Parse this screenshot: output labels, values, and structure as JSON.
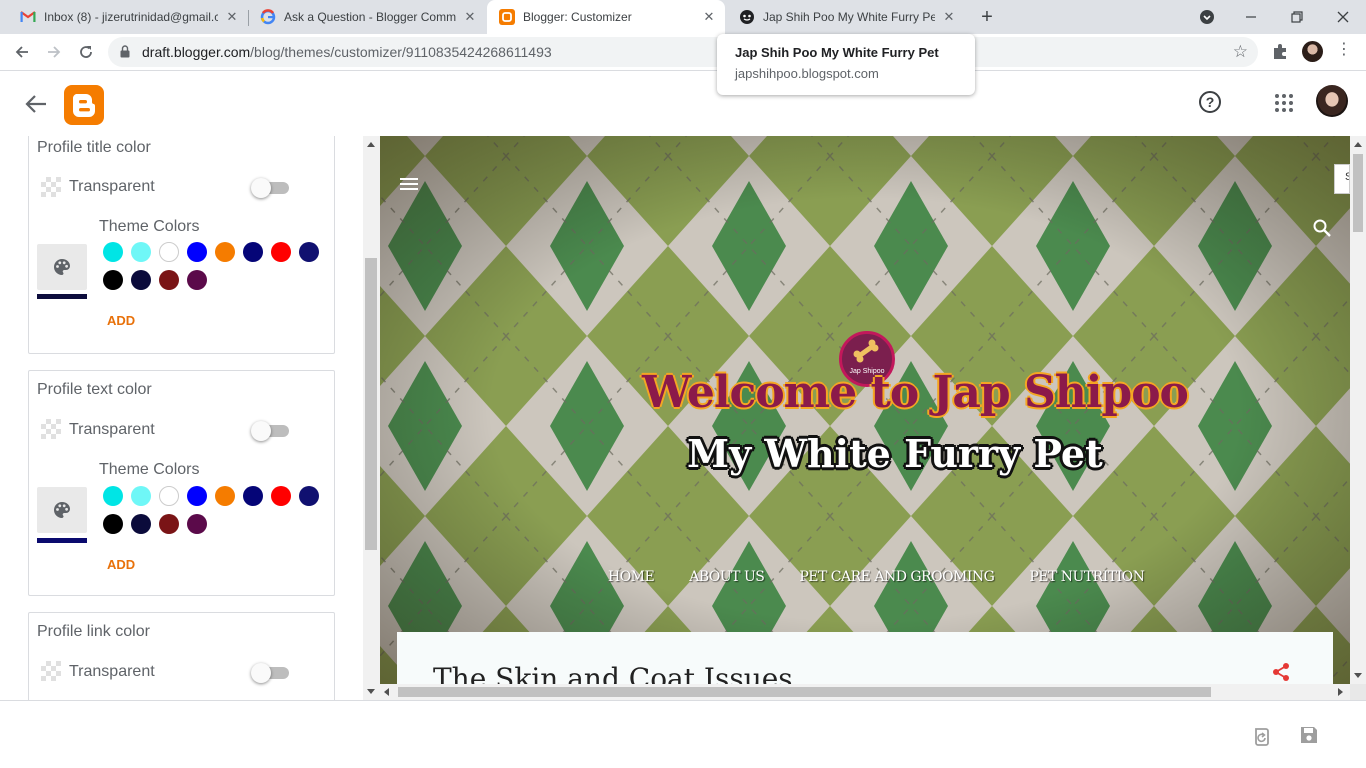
{
  "browser": {
    "tabs": [
      {
        "title": "Inbox (8) - jizerutrinidad@gmail.c",
        "favicon": "gmail-icon",
        "active": false
      },
      {
        "title": "Ask a Question - Blogger Commu",
        "favicon": "google-icon",
        "active": false
      },
      {
        "title": "Blogger: Customizer",
        "favicon": "blogger-icon",
        "active": true
      },
      {
        "title": "Jap Shih Poo My White Furry Pet",
        "favicon": "site-icon",
        "active": false
      }
    ],
    "new_tab": "+",
    "address": {
      "host": "draft.blogger.com",
      "path": "/blog/themes/customizer/9110835424268611493"
    },
    "tooltip": {
      "title": "Jap Shih Poo My White Furry Pet",
      "url": "japshihpoo.blogspot.com"
    }
  },
  "settings": {
    "cards": [
      {
        "title": "Profile title color",
        "transparent_label": "Transparent",
        "transparent_on": false,
        "theme_colors_label": "Theme Colors",
        "selected_color": "#0d0d3d",
        "add_label": "ADD"
      },
      {
        "title": "Profile text color",
        "transparent_label": "Transparent",
        "transparent_on": false,
        "theme_colors_label": "Theme Colors",
        "selected_color": "#0a0a6e",
        "add_label": "ADD"
      },
      {
        "title": "Profile link color",
        "transparent_label": "Transparent",
        "transparent_on": false
      }
    ],
    "theme_colors": [
      "#00e5e5",
      "#6ff7f7",
      "#ffffff",
      "#0000ff",
      "#f57c00",
      "#050577",
      "#ff0000",
      "#101070",
      "#000000",
      "#0b0b3b",
      "#7a1416",
      "#5b0a4a"
    ]
  },
  "preview": {
    "logo_line1": "Welcome to Jap Shipoo",
    "logo_line2": "My White Furry Pet",
    "badge_text": "Jap Shipoo",
    "nav": [
      "HOME",
      "ABOUT US",
      "PET CARE AND GROOMING",
      "PET NUTRITION"
    ],
    "post_title": "The Skin and Coat Issues",
    "side_widget": "S"
  },
  "colors": {
    "accent": "#e8710a",
    "blogger_orange": "#f57c00"
  }
}
